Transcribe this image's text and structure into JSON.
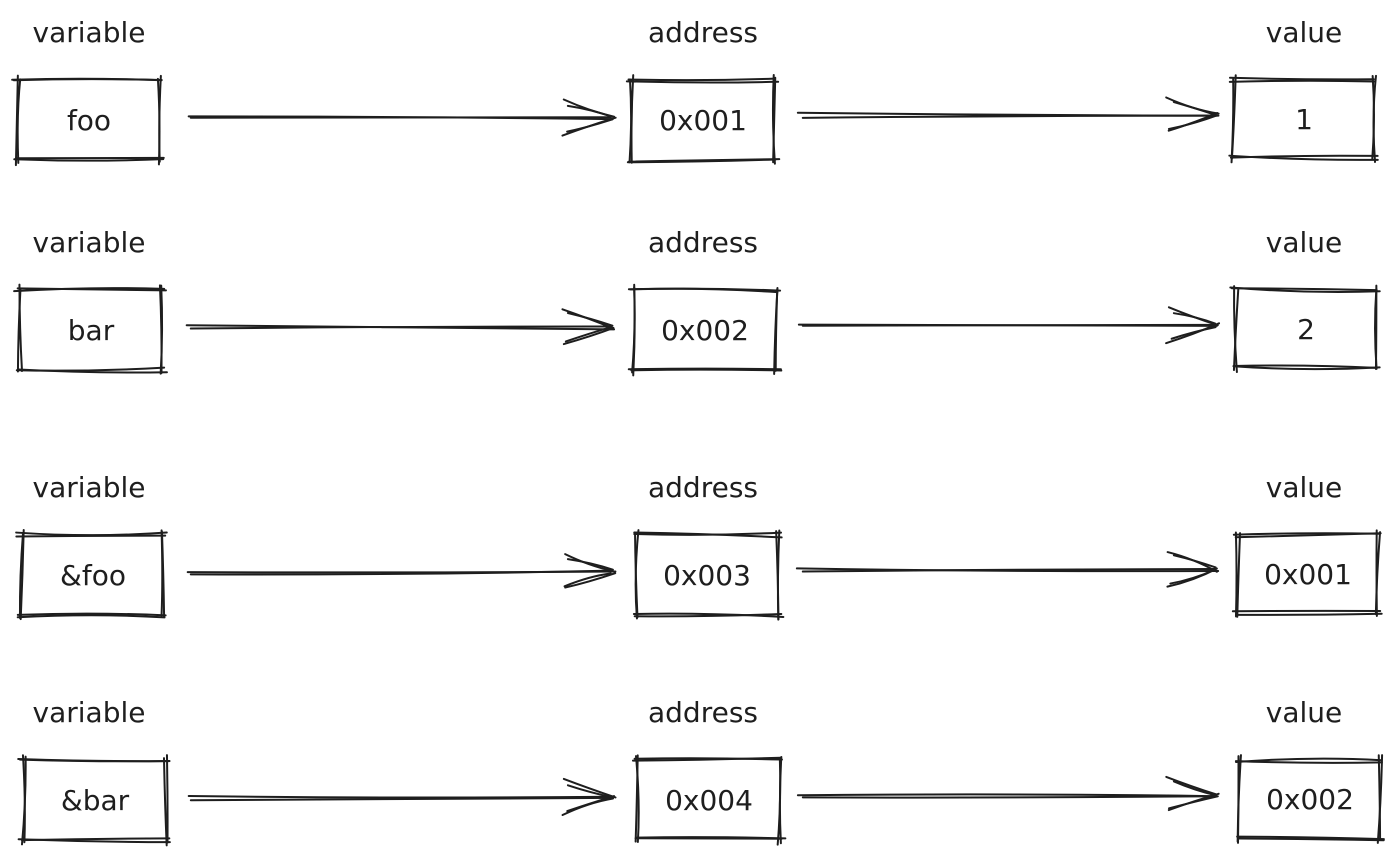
{
  "diagram": {
    "title": "",
    "column_headers": {
      "variable": "variable",
      "address": "address",
      "value": "value"
    },
    "rows": [
      {
        "variable": "foo",
        "address": "0x001",
        "value": "1"
      },
      {
        "variable": "bar",
        "address": "0x002",
        "value": "2"
      },
      {
        "variable": "&foo",
        "address": "0x003",
        "value": "0x001"
      },
      {
        "variable": "&bar",
        "address": "0x004",
        "value": "0x002"
      }
    ],
    "edges": [
      {
        "from": "variable",
        "to": "address"
      },
      {
        "from": "address",
        "to": "value"
      }
    ],
    "colors": {
      "stroke": "#1e1e1e",
      "background": "#ffffff"
    }
  }
}
